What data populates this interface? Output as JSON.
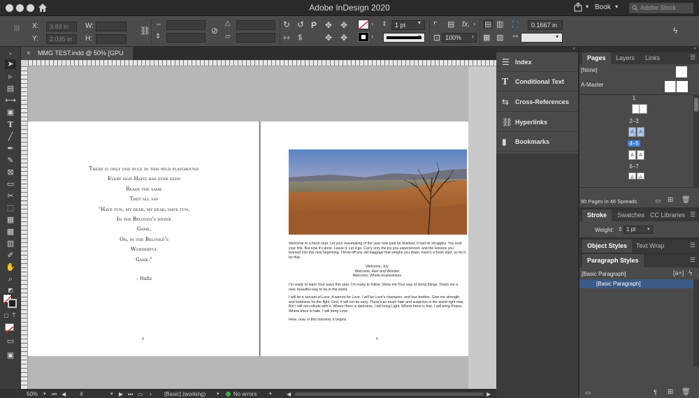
{
  "window": {
    "title": "Adobe InDesign 2020",
    "workspace": "Book",
    "stock_search_placeholder": "Adobe Stock"
  },
  "control_bar": {
    "x_label": "X:",
    "x_value": "3.83 in",
    "y_label": "Y:",
    "y_value": "2.035 in",
    "w_label": "W:",
    "w_value": "",
    "h_label": "H:",
    "h_value": "",
    "stroke_weight": "1 pt",
    "opacity": "100%",
    "gap_value": "0.1667 in",
    "fx_label": "fx."
  },
  "document_tab": {
    "label": "MMG TEST.indd @ 50% [GPU Preview]",
    "close": "×"
  },
  "left_page": {
    "poem": [
      "There is only one rule in this wild playground",
      "Every sign Hafiz has ever seen",
      "Reads the same",
      "They all say",
      "“Have fun, my dear, my dear, have fun,",
      "In the Beloved’s divine",
      "Game,",
      "Oh, in the Beloved’s",
      "Wonderful",
      "Game.”"
    ],
    "attribution": "– Hafiz",
    "page_number": "4"
  },
  "right_page": {
    "paragraph_1": "Welcome to a fresh start. Let your leavetaking of the year now past be finished. It had its struggles. You took your hits. But now it’s done. Leave it. Let it go. Carry only the joy you experienced, and the lessons you learned into this new beginning. Throw off any old baggage that weighs you down. Here’s a fresh start, so let it be that.",
    "welcome_lines": [
      "Welcome, Joy.",
      "Welcome, Awe and Wonder.",
      "Welcome, Whole-heartedness."
    ],
    "paragraph_2": "I’m ready to learn Your ways this year. I’m ready to follow. Show me Your way of doing things. Teach me a new, beautiful way to be in the world.",
    "paragraph_3": "I will be a servant of Love. A warrior for Love. I will be Love’s champion, and true brother. Give me strength and boldness for the fight, God. It will not be easy. There’s so much hate and suspicion in the world right now. But I will not collude with it. Where there is darkness, I will bring Light. Where there is fear, I will bring Peace. Where there is hate, I will bring Love.",
    "paragraph_4": "Here, now, in this moment, it begins.",
    "page_number": "5"
  },
  "mid_panel": {
    "items": [
      {
        "label": "Index",
        "icon": "index-icon"
      },
      {
        "label": "Conditional Text",
        "icon": "conditional-text-icon"
      },
      {
        "label": "Cross-References",
        "icon": "cross-references-icon"
      },
      {
        "label": "Hyperlinks",
        "icon": "hyperlinks-icon"
      },
      {
        "label": "Bookmarks",
        "icon": "bookmarks-icon"
      }
    ]
  },
  "pages_panel": {
    "tabs": [
      "Pages",
      "Layers",
      "Links"
    ],
    "none_label": "[None]",
    "master_label": "A-Master",
    "spreads": [
      {
        "label": "1",
        "pages": [
          ""
        ]
      },
      {
        "label": "2–3",
        "pages": [
          "A",
          "A"
        ]
      },
      {
        "label": "4–5",
        "pages": [
          "A",
          "A"
        ],
        "selected": true
      },
      {
        "label": "6–7",
        "pages": [
          "A",
          "A"
        ]
      }
    ],
    "footer": "90 Pages in 46 Spreads"
  },
  "stroke_panel": {
    "tabs": [
      "Stroke",
      "Swatches",
      "CC Libraries"
    ],
    "weight_label": "Weight:",
    "weight_value": "1 pt"
  },
  "object_styles_panel": {
    "tabs": [
      "Object Styles",
      "Text Wrap"
    ]
  },
  "paragraph_styles_panel": {
    "title": "Paragraph Styles",
    "current": "[Basic Paragraph]",
    "items": [
      "[Basic Paragraph]"
    ]
  },
  "status_bar": {
    "zoom": "50%",
    "page": "4",
    "style": "[Basic] (working)",
    "preflight": "No errors"
  },
  "colors": {
    "accent": "#3d7fd6",
    "preflight_ok": "#3fae49",
    "canvas": "#b7b7b7"
  }
}
